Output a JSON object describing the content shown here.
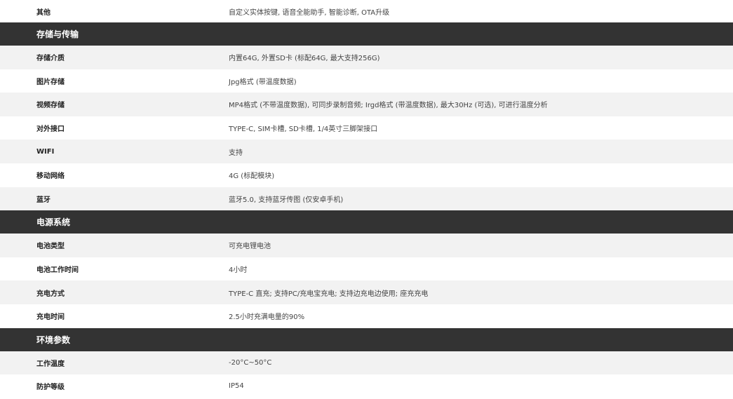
{
  "top_row": {
    "label": "其他",
    "value": "自定义实体按键, 语音全能助手, 智能诊断, OTA升级"
  },
  "sections": [
    {
      "title": "存储与传输",
      "rows": [
        {
          "label": "存储介质",
          "value": "内置64G, 外置SD卡 (标配64G, 最大支持256G)"
        },
        {
          "label": "图片存储",
          "value": "Jpg格式 (带温度数据)"
        },
        {
          "label": "视频存储",
          "value": "MP4格式 (不带温度数据), 可同步录制音频; Irgd格式 (带温度数据), 最大30Hz (可选), 可进行温度分析"
        },
        {
          "label": "对外接口",
          "value": "TYPE-C, SIM卡槽, SD卡槽, 1/4英寸三脚架接口"
        },
        {
          "label": "WIFI",
          "value": "支持"
        },
        {
          "label": "移动网络",
          "value": "4G (标配模块)"
        },
        {
          "label": "蓝牙",
          "value": "蓝牙5.0, 支持蓝牙传图 (仅安卓手机)"
        }
      ]
    },
    {
      "title": "电源系统",
      "rows": [
        {
          "label": "电池类型",
          "value": "可充电锂电池"
        },
        {
          "label": "电池工作时间",
          "value": "4小时"
        },
        {
          "label": "充电方式",
          "value": "TYPE-C 直充; 支持PC/充电宝充电; 支持边充电边使用; 座充充电"
        },
        {
          "label": "充电时间",
          "value": "2.5小时充满电量的90%"
        }
      ]
    },
    {
      "title": "环境参数",
      "rows": [
        {
          "label": "工作温度",
          "value": "-20°C~50°C"
        },
        {
          "label": "防护等级",
          "value": "IP54"
        }
      ]
    }
  ]
}
